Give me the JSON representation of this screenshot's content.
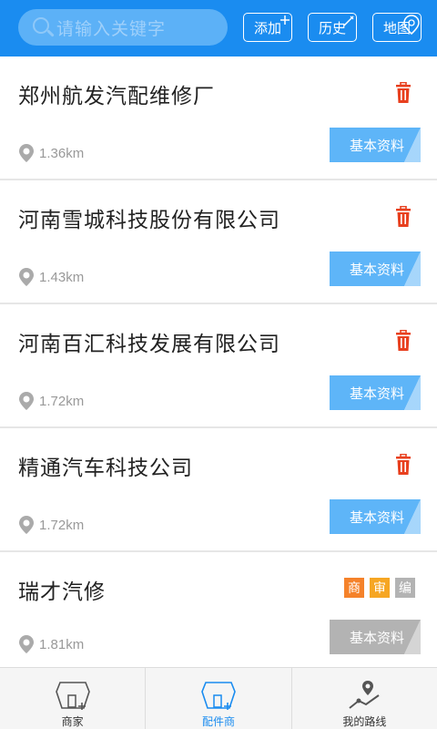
{
  "header": {
    "search_placeholder": "请输入关键字",
    "add_label": "添加",
    "history_label": "历史",
    "map_label": "地图"
  },
  "colors": {
    "primary": "#1a8cf0",
    "info_button": "#5eb5f8",
    "info_button_disabled": "#b3b3b3",
    "delete": "#e8401f",
    "tag_shang": "#f5822a",
    "tag_shen": "#f6a623",
    "tag_bian": "#b3b3b3"
  },
  "list": {
    "items": [
      {
        "name": "郑州航发汽配维修厂",
        "distance": "1.36km",
        "action": "基本资料"
      },
      {
        "name": "河南雪城科技股份有限公司",
        "distance": "1.43km",
        "action": "基本资料"
      },
      {
        "name": "河南百汇科技发展有限公司",
        "distance": "1.72km",
        "action": "基本资料"
      },
      {
        "name": "精通汽车科技公司",
        "distance": "1.72km",
        "action": "基本资料"
      },
      {
        "name": "瑞才汽修",
        "distance": "1.81km",
        "action": "基本资料",
        "tags": [
          "商",
          "审",
          "编"
        ]
      }
    ]
  },
  "bottom_nav": {
    "items": [
      {
        "label": "商家",
        "icon": "store-icon"
      },
      {
        "label": "配件商",
        "icon": "parts-store-icon",
        "active": true
      },
      {
        "label": "我的路线",
        "icon": "route-icon"
      }
    ]
  }
}
